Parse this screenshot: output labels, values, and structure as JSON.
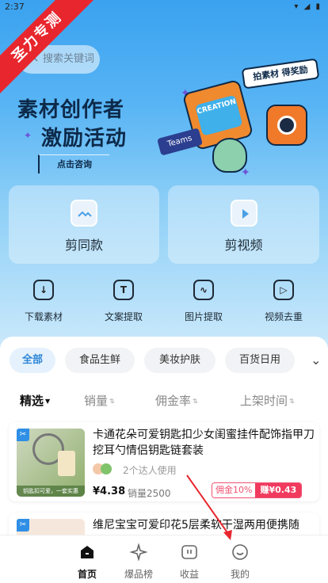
{
  "status_bar": {
    "time": "2:37"
  },
  "ribbon": {
    "text": "圣力专测"
  },
  "search": {
    "placeholder": "搜索关键词"
  },
  "banner": {
    "title_line1": "素材创作者",
    "title_line2": "激励活动",
    "consult_button": "点击咨询",
    "tagline": "拍素材 得奖励",
    "board_text": "CREATION",
    "teams_text": "Teams"
  },
  "cards": [
    {
      "label": "剪同款",
      "icon": "template-icon"
    },
    {
      "label": "剪视频",
      "icon": "video-play-icon"
    }
  ],
  "tools": [
    {
      "label": "下载素材",
      "icon": "download-icon"
    },
    {
      "label": "文案提取",
      "icon": "text-extract-icon"
    },
    {
      "label": "图片提取",
      "icon": "image-extract-icon"
    },
    {
      "label": "视频去重",
      "icon": "video-dedupe-icon"
    }
  ],
  "categories": [
    "全部",
    "食品生鲜",
    "美妆护肤",
    "百货日用"
  ],
  "active_category": "全部",
  "sort": [
    "精选",
    "销量",
    "佣金率",
    "上架时间"
  ],
  "products": [
    {
      "title": "卡通花朵可爱钥匙扣少女闺蜜挂件配饰指甲刀挖耳勺情侣钥匙链套装",
      "users": "2个达人使用",
      "price": "¥4.38",
      "sales": "销量2500",
      "commission_label": "佣金10%",
      "earn": "赚¥0.43",
      "image_caption": "钥匙扣可爱，一套实惠"
    },
    {
      "title": "维尼宝宝可爱印花5层柔软干湿两用便携随"
    }
  ],
  "tabbar": [
    {
      "label": "首页",
      "icon": "home-icon"
    },
    {
      "label": "爆品榜",
      "icon": "sparkle-icon"
    },
    {
      "label": "收益",
      "icon": "earnings-icon"
    },
    {
      "label": "我的",
      "icon": "profile-icon"
    }
  ],
  "active_tab": "首页",
  "colors": {
    "accent": "#2d86d6",
    "price_red": "#f03a5e",
    "hero_blue": "#3aa2f0"
  }
}
